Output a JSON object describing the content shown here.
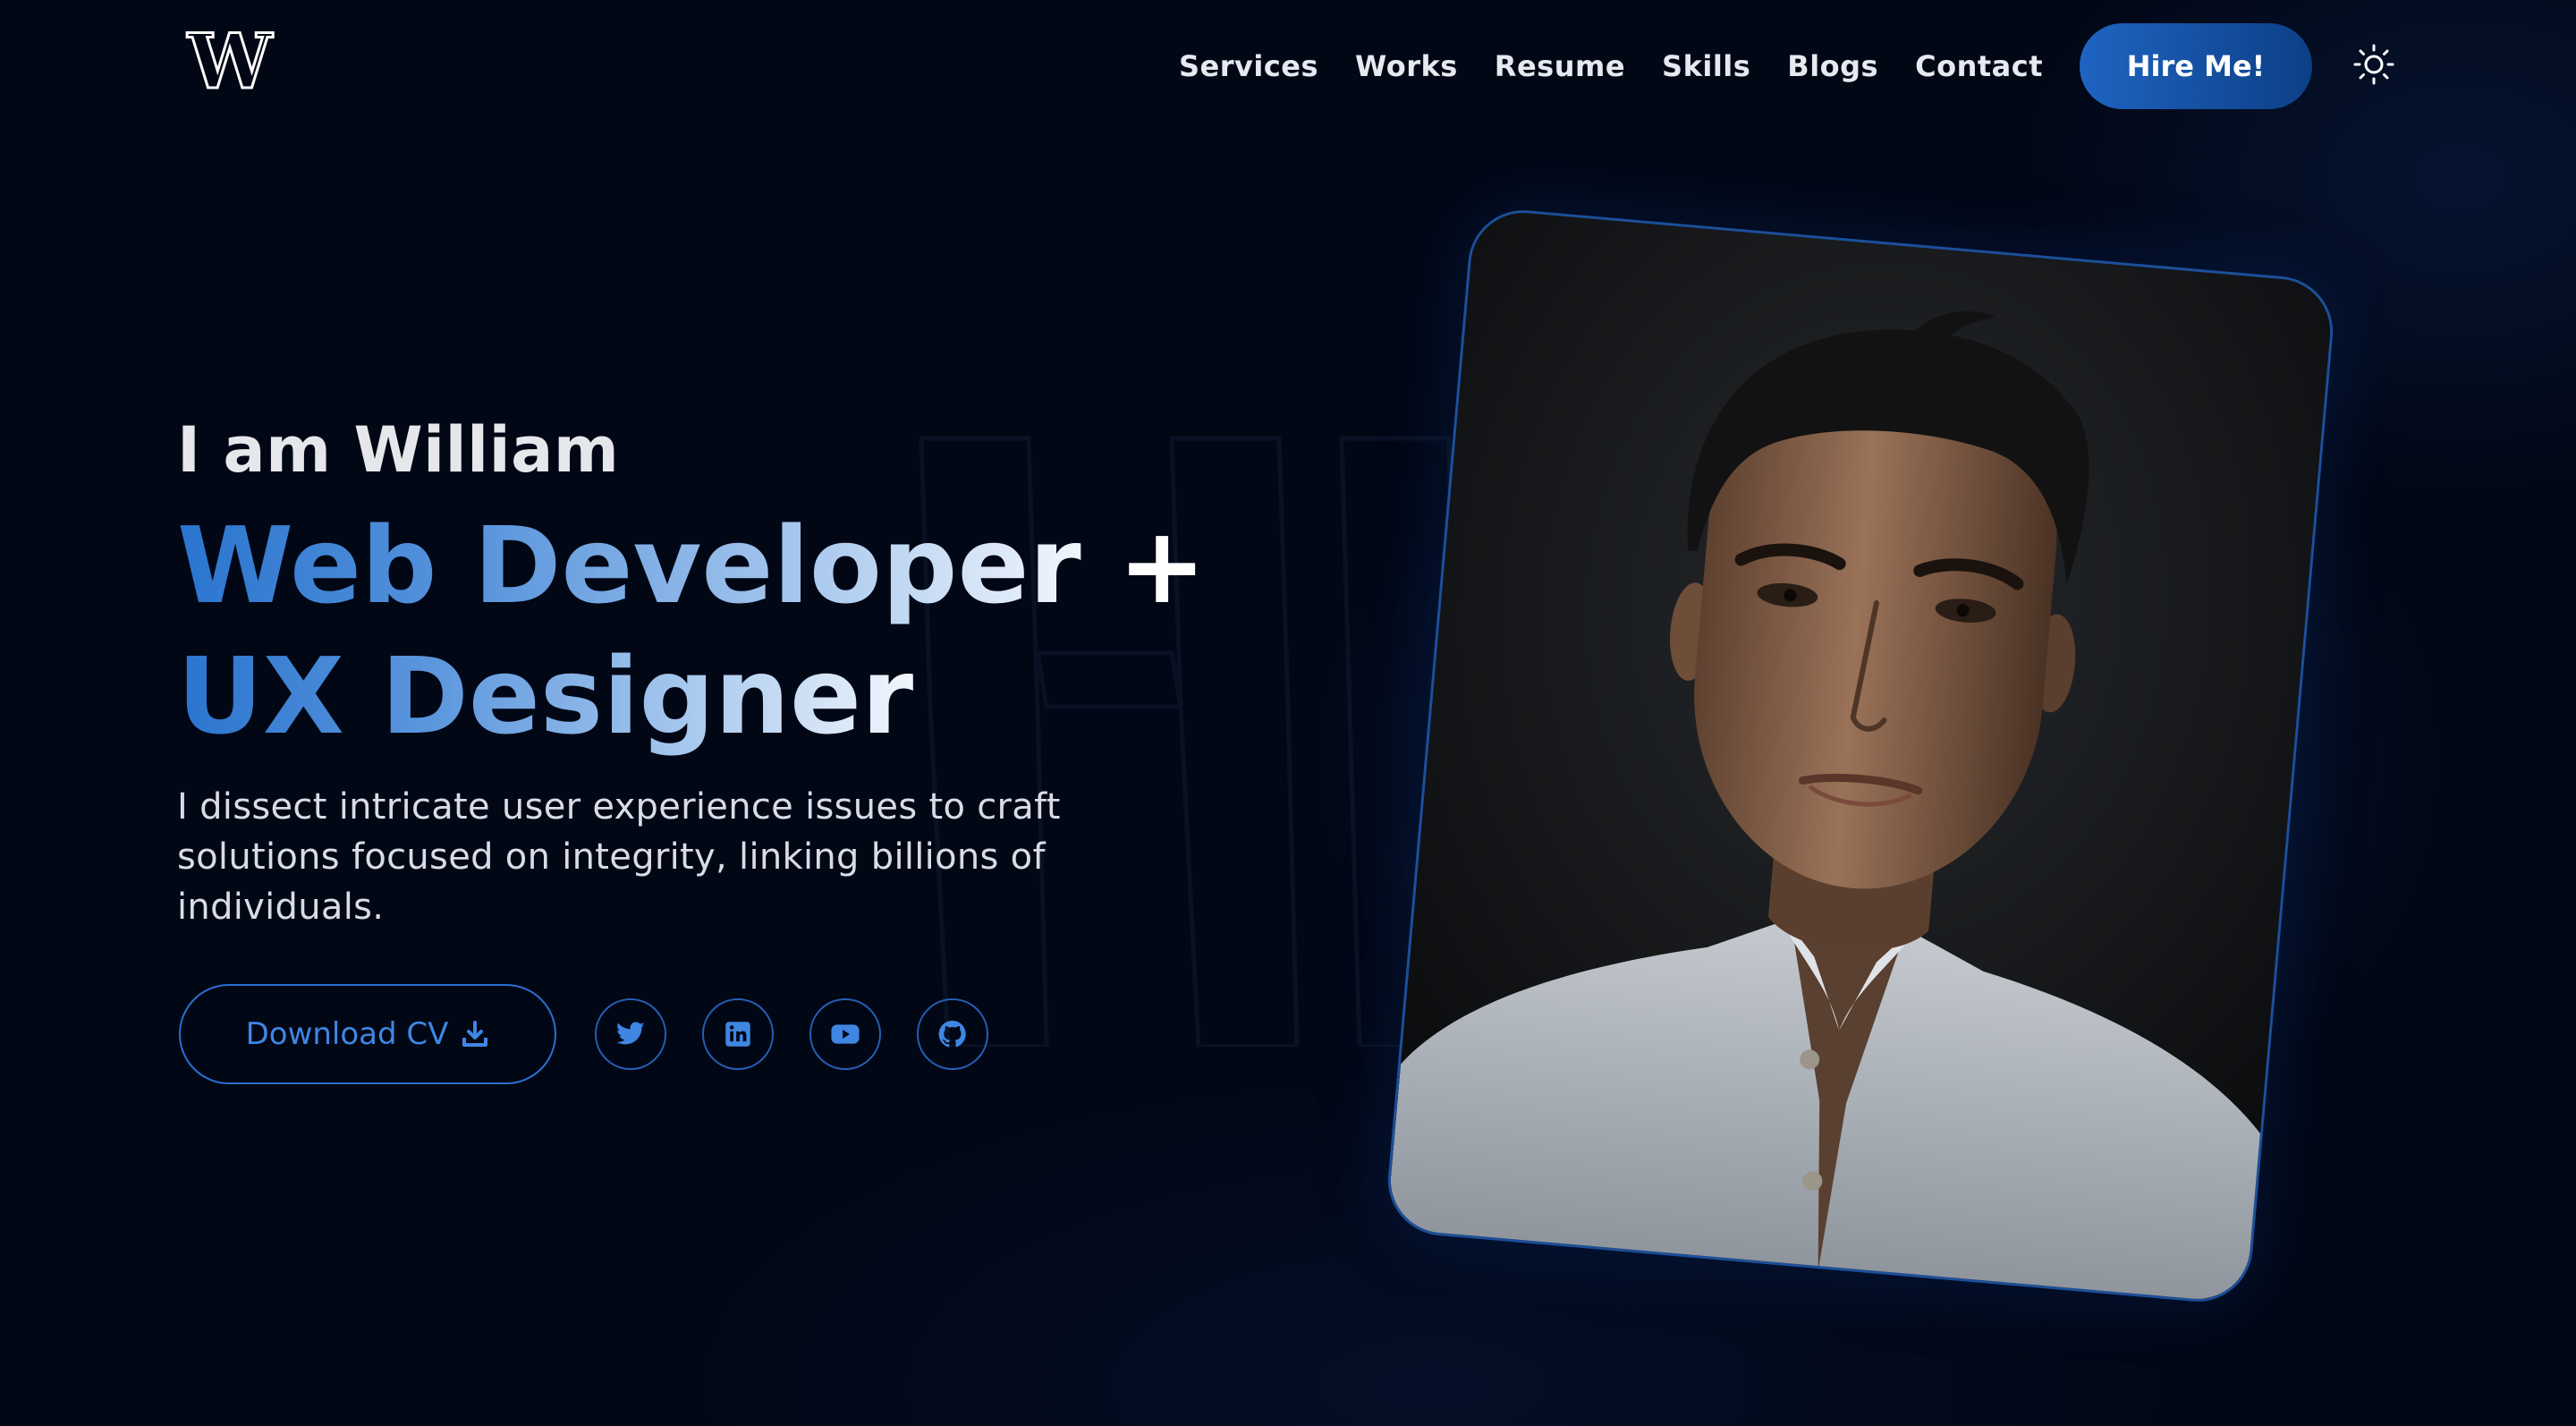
{
  "header": {
    "logo_letter": "W",
    "nav": [
      "Services",
      "Works",
      "Resume",
      "Skills",
      "Blogs",
      "Contact"
    ],
    "hire_label": "Hire Me!",
    "theme_toggle_icon": "sun-icon"
  },
  "hero": {
    "greeting": "I am William",
    "role_line1": "Web Developer",
    "role_plus": "+",
    "role_line2": "UX Designer",
    "intro": "I dissect intricate user experience issues to craft solutions focused on integrity, linking billions of individuals.",
    "download_label": "Download CV",
    "download_icon": "download-icon",
    "socials": [
      "twitter-icon",
      "linkedin-icon",
      "youtube-icon",
      "github-icon"
    ],
    "portrait_alt": "Portrait photo"
  },
  "colors": {
    "background": "#020716",
    "accent": "#2a6fd0",
    "accent_dark": "#0d3f86",
    "text": "#e6e9ef"
  }
}
